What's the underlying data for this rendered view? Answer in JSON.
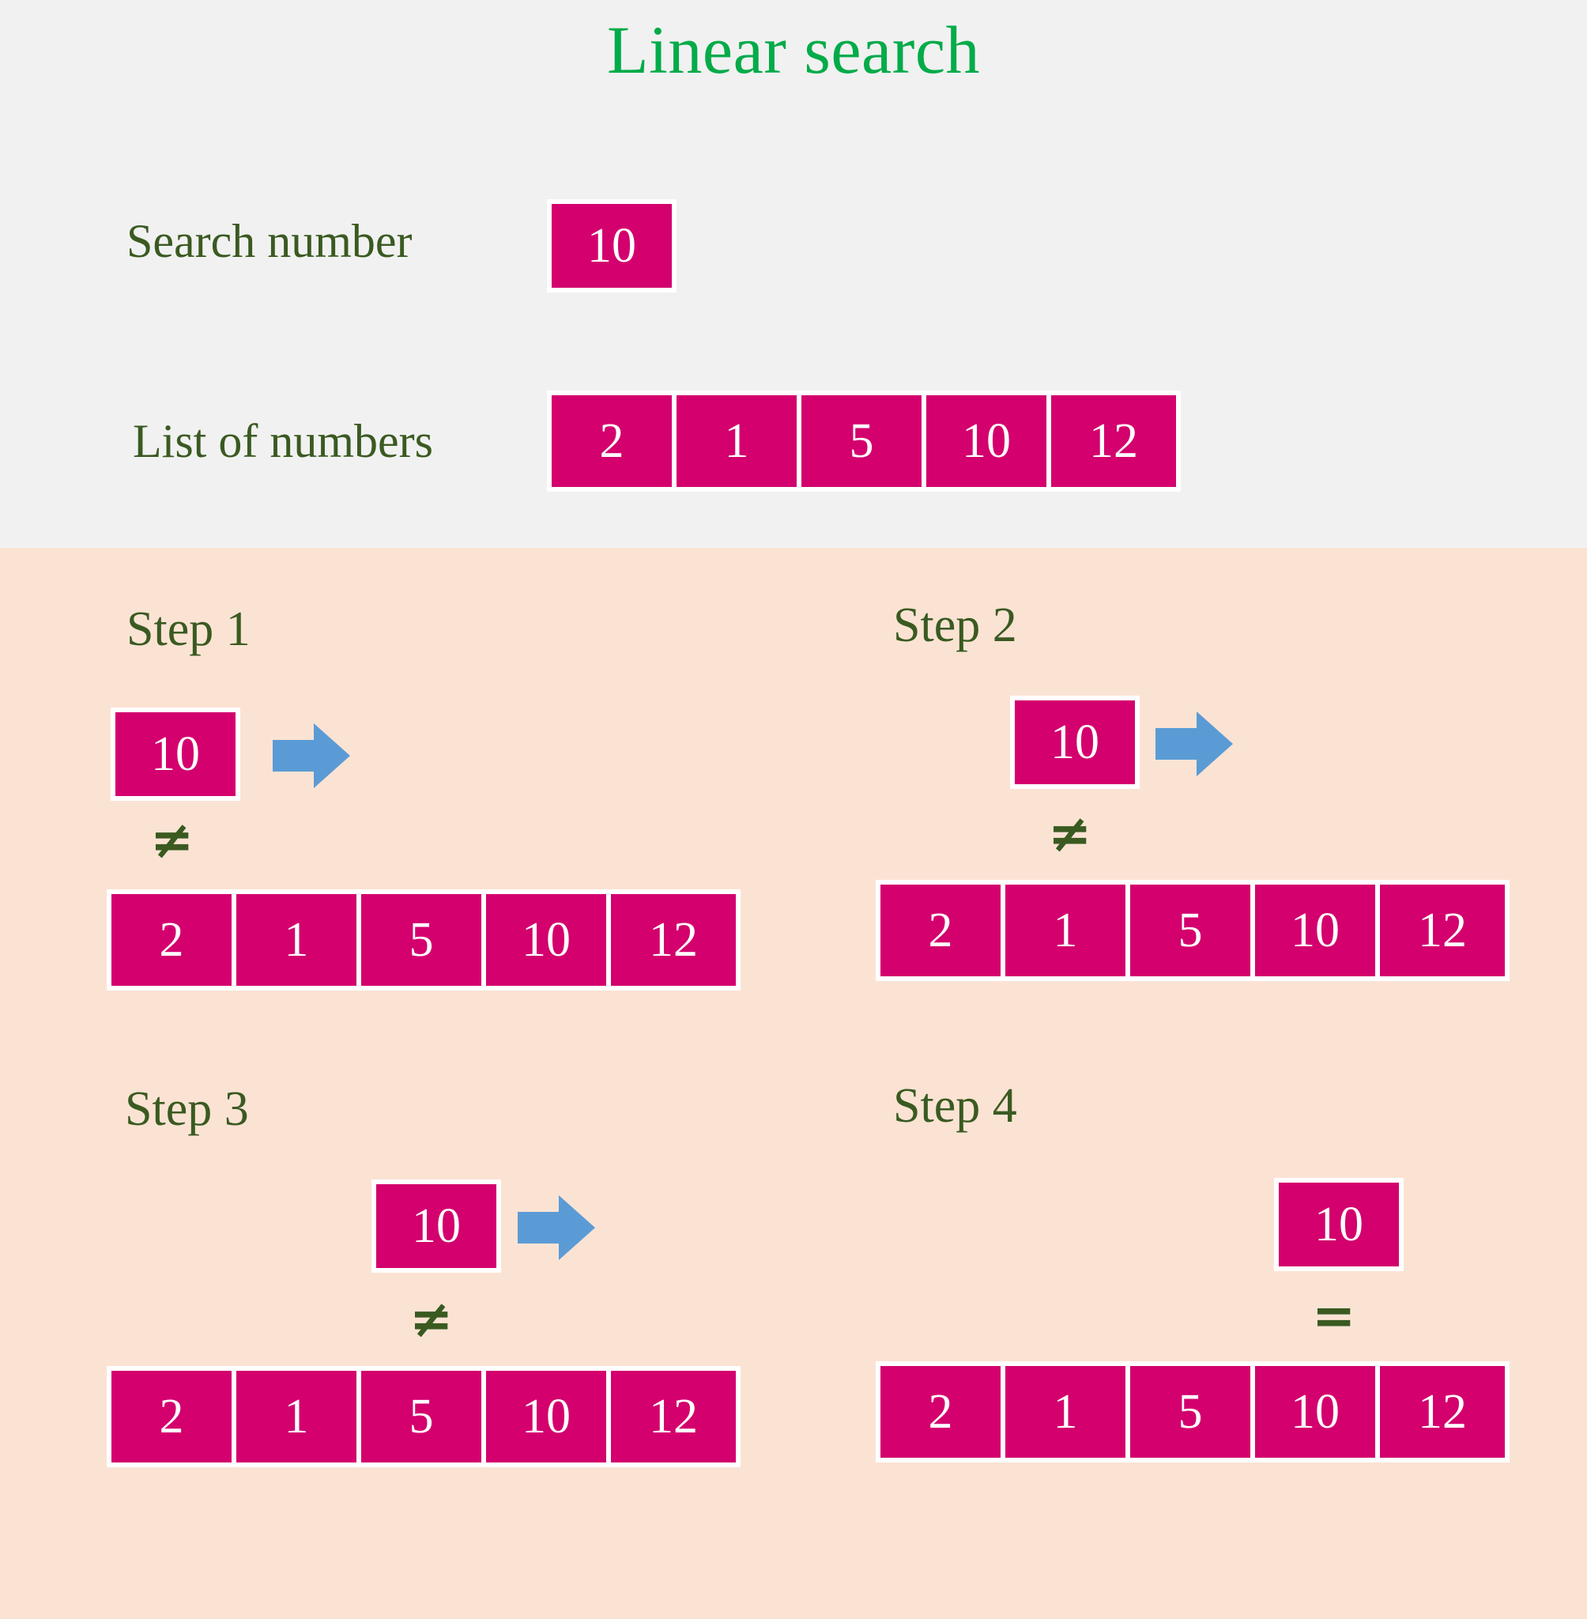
{
  "title": "Linear search",
  "colors": {
    "title_green": "#03ab49",
    "label_green": "#3a5a21",
    "cell_magenta": "#d3006e",
    "arrow_blue": "#5b9bd5",
    "top_background": "#f1f1f1",
    "steps_background": "#fbe3d4",
    "cell_text": "#ffffff",
    "cell_border": "#ffffff"
  },
  "definition": {
    "search_label": "Search number",
    "search_value": "10",
    "list_label": "List of numbers",
    "list_values": [
      "2",
      "1",
      "5",
      "10",
      "12"
    ]
  },
  "steps": [
    {
      "label": "Step 1",
      "search_value": "10",
      "comparison": "≠",
      "has_arrow": true,
      "compare_index": 0,
      "list_values": [
        "2",
        "1",
        "5",
        "10",
        "12"
      ]
    },
    {
      "label": "Step 2",
      "search_value": "10",
      "comparison": "≠",
      "has_arrow": true,
      "compare_index": 1,
      "list_values": [
        "2",
        "1",
        "5",
        "10",
        "12"
      ]
    },
    {
      "label": "Step 3",
      "search_value": "10",
      "comparison": "≠",
      "has_arrow": true,
      "compare_index": 2,
      "list_values": [
        "2",
        "1",
        "5",
        "10",
        "12"
      ]
    },
    {
      "label": "Step 4",
      "search_value": "10",
      "comparison": "=",
      "has_arrow": false,
      "compare_index": 3,
      "list_values": [
        "2",
        "1",
        "5",
        "10",
        "12"
      ]
    }
  ]
}
